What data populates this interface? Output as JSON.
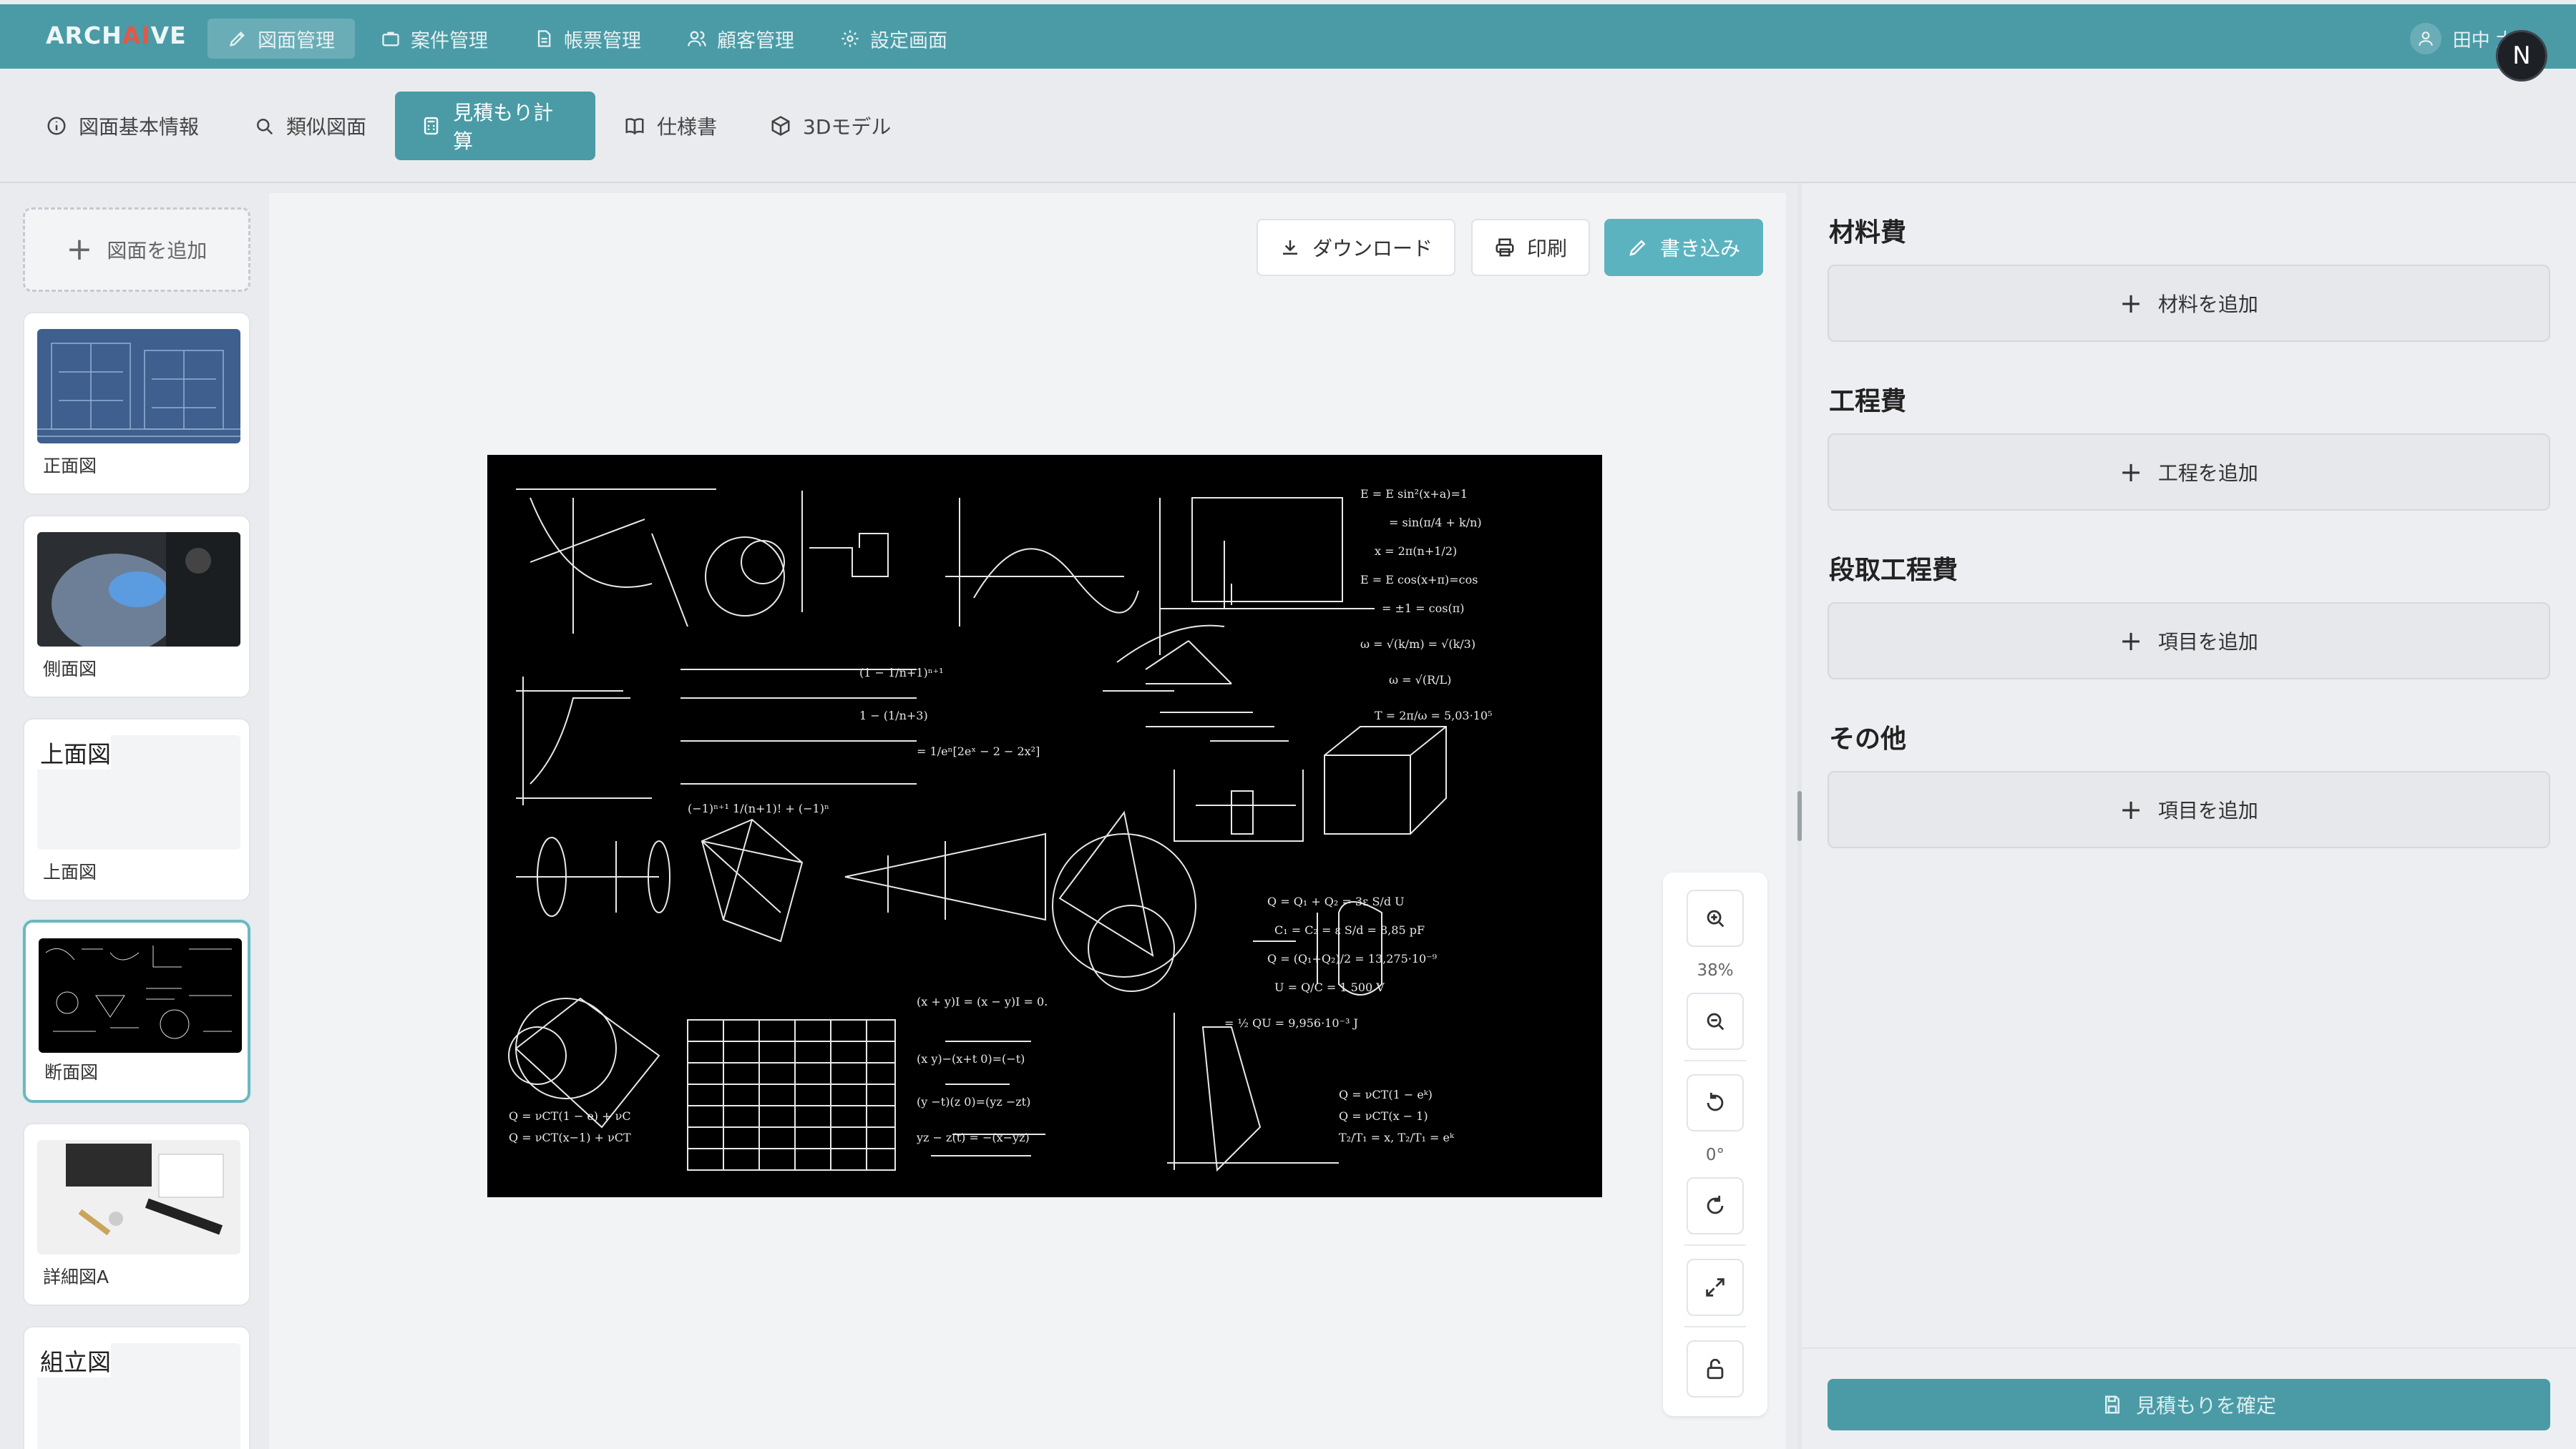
{
  "app": {
    "logo_pre": "ARCH",
    "logo_ai": "AI",
    "logo_post": "VE",
    "brand_color": "#4a9ba6",
    "accent_color": "#e2574c"
  },
  "topnav": {
    "items": [
      {
        "label": "図面管理",
        "icon": "pencil-ruler-icon",
        "active": true
      },
      {
        "label": "案件管理",
        "icon": "briefcase-icon"
      },
      {
        "label": "帳票管理",
        "icon": "document-icon"
      },
      {
        "label": "顧客管理",
        "icon": "users-icon"
      },
      {
        "label": "設定画面",
        "icon": "gear-icon"
      }
    ],
    "user_name": "田中 太郎",
    "avatar_initial": "N"
  },
  "subtabs": {
    "items": [
      {
        "label": "図面基本情報",
        "icon": "info-icon"
      },
      {
        "label": "類似図面",
        "icon": "search-icon"
      },
      {
        "label": "見積もり計算",
        "icon": "calculator-icon",
        "active": true
      },
      {
        "label": "仕様書",
        "icon": "book-icon"
      },
      {
        "label": "3Dモデル",
        "icon": "cube-icon"
      }
    ]
  },
  "drawings": {
    "add_label": "図面を追加",
    "items": [
      {
        "caption": "正面図",
        "image": "blueprint"
      },
      {
        "caption": "側面図",
        "image": "photo"
      },
      {
        "caption": "上面図",
        "image": "broken",
        "alt": "上面図"
      },
      {
        "caption": "断面図",
        "image": "formulas",
        "selected": true
      },
      {
        "caption": "詳細図A",
        "image": "desk"
      },
      {
        "caption": "",
        "image": "broken",
        "alt": "組立図"
      }
    ]
  },
  "viewer": {
    "download_label": "ダウンロード",
    "print_label": "印刷",
    "write_label": "書き込み",
    "zoom": "38%",
    "rotation": "0°"
  },
  "estimate": {
    "sections": [
      {
        "title": "材料費",
        "add_label": "材料を追加"
      },
      {
        "title": "工程費",
        "add_label": "工程を追加"
      },
      {
        "title": "段取工程費",
        "add_label": "項目を追加"
      },
      {
        "title": "その他",
        "add_label": "項目を追加"
      }
    ],
    "confirm_label": "見積もりを確定"
  }
}
